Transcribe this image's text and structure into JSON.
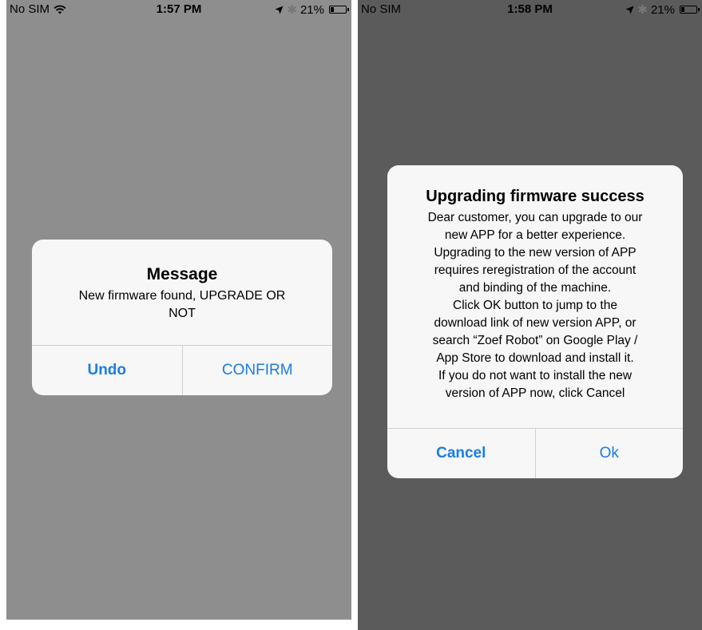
{
  "left_screen": {
    "status_bar": {
      "carrier": "No SIM",
      "time": "1:57 PM",
      "battery": "21%",
      "battery_level": 0.21
    },
    "alert": {
      "title": "Message",
      "message_lines": [
        "New firmware found, UPGRADE OR",
        "NOT"
      ],
      "buttons": {
        "undo": "Undo",
        "confirm": "CONFIRM"
      }
    }
  },
  "right_screen": {
    "status_bar": {
      "carrier": "No SIM",
      "time": "1:58 PM",
      "battery": "21%",
      "battery_level": 0.21
    },
    "alert": {
      "title": "Upgrading firmware success",
      "message_lines": [
        "Dear customer, you can upgrade to our",
        "new APP for a better experience.",
        "Upgrading to the new version of APP",
        "requires reregistration of the account",
        "and binding of the machine.",
        "Click OK button to jump to the",
        "download link of new version APP, or",
        "search “Zoef Robot” on Google Play /",
        "App Store to download and install it.",
        "If you do not want to install the new",
        "version of APP now, click Cancel"
      ],
      "buttons": {
        "cancel": "Cancel",
        "ok": "Ok"
      }
    }
  },
  "colors": {
    "accent": "#1a7de5",
    "left_background": "#8e8e8e",
    "right_background": "#5b5b5b",
    "alert_background": "#f7f7f7"
  },
  "icons": {
    "wifi": "wifi-icon",
    "location": "location-arrow-icon",
    "bluetooth": "bluetooth-icon",
    "battery": "battery-icon"
  }
}
